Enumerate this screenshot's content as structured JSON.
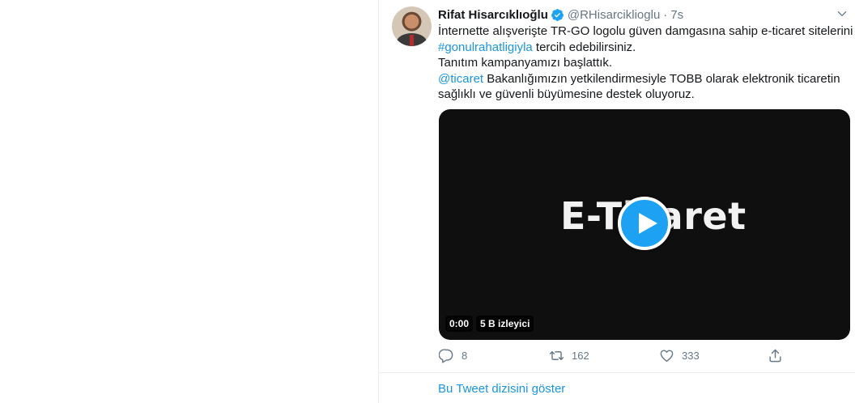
{
  "tweet": {
    "author_name": "Rifat Hisarcıklıoğlu",
    "author_handle": "@RHisarciklioglu",
    "separator": "·",
    "time": "7s",
    "text_line1": "İnternette alışverişte TR-GO logolu güven damgasına sahip e-ticaret sitelerini",
    "hashtag": "#gonulrahatligiyla",
    "text_line2_rest": " tercih edebilirsiniz.",
    "text_line3": "Tanıtım kampanyamızı başlattık.",
    "mention": "@ticaret",
    "text_line4_rest": " Bakanlığımızın yetkilendirmesiyle TOBB olarak elektronik ticaretin",
    "text_line5": "sağlıklı ve güvenli büyümesine destek oluyoruz.",
    "video": {
      "title_text": "E-Ticaret",
      "time": "0:00",
      "views": "5 B izleyici"
    },
    "actions": {
      "replies": "8",
      "retweets": "162",
      "likes": "333"
    },
    "colors": {
      "link": "#1b95e0",
      "play_button": "#1da1f2",
      "muted": "#657786"
    },
    "icons": [
      "verified-badge-icon",
      "chevron-down-icon",
      "play-icon",
      "reply-icon",
      "retweet-icon",
      "like-icon",
      "share-icon"
    ]
  },
  "thread_link": "Bu Tweet dizisini göster"
}
